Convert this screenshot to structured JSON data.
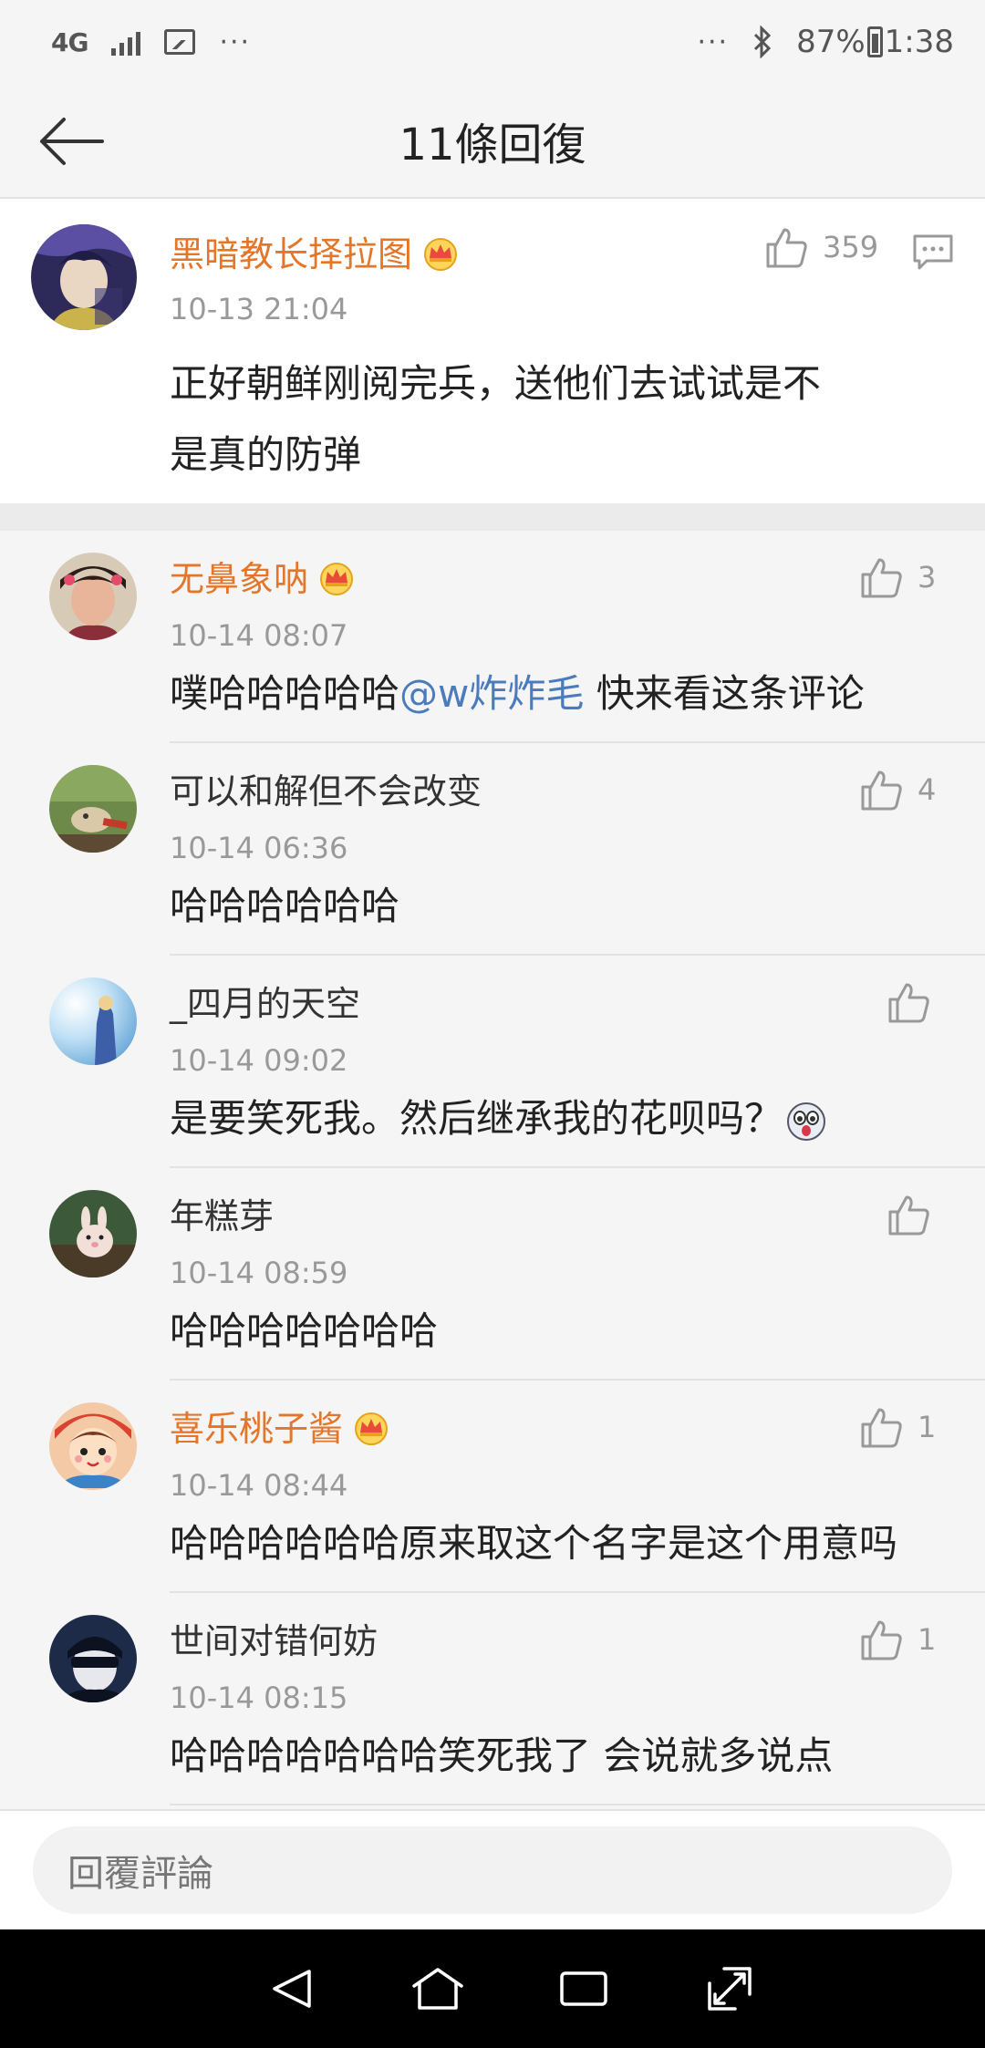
{
  "status_bar": {
    "network": "4G",
    "dots": "···",
    "right_dots": "···",
    "battery": "87%",
    "time": "1:38"
  },
  "header": {
    "title": "11條回復"
  },
  "main_comment": {
    "username": "黑暗教长择拉图",
    "time": "10-13 21:04",
    "like_count": "359",
    "text_line1": "正好朝鲜刚阅完兵，送他们去试试是不",
    "text_line2": "是真的防弹"
  },
  "replies": [
    {
      "username": "无鼻象呐",
      "vip": true,
      "time": "10-14 08:07",
      "like_count": "3",
      "text": "噗哈哈哈哈哈",
      "mention": "@w炸炸毛",
      "text_after": " 快来看这条评论"
    },
    {
      "username": "可以和解但不会改变",
      "vip": false,
      "time": "10-14 06:36",
      "like_count": "4",
      "text": "哈哈哈哈哈哈"
    },
    {
      "username": "_四月的天空",
      "vip": false,
      "time": "10-14 09:02",
      "like_count": "",
      "text": "是要笑死我。然后继承我的花呗吗？"
    },
    {
      "username": "年糕芽",
      "vip": false,
      "time": "10-14 08:59",
      "like_count": "",
      "text": "哈哈哈哈哈哈哈"
    },
    {
      "username": "喜乐桃子酱",
      "vip": true,
      "time": "10-14 08:44",
      "like_count": "1",
      "text": "哈哈哈哈哈哈原来取这个名字是这个用意吗"
    },
    {
      "username": "世间对错何妨",
      "vip": false,
      "time": "10-14 08:15",
      "like_count": "1",
      "text": "哈哈哈哈哈哈哈笑死我了 会说就多说点"
    }
  ],
  "input": {
    "placeholder": "回覆評論"
  },
  "colors": {
    "vip_name": "#e4762a",
    "mention": "#4a7bbd",
    "crown": "#f5b82e"
  }
}
